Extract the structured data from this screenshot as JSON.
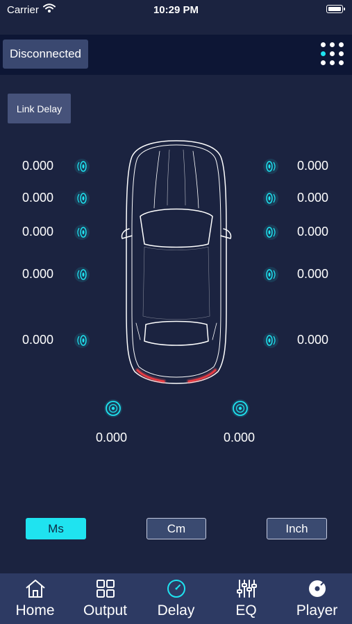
{
  "status_bar": {
    "carrier": "Carrier",
    "time": "10:29 PM"
  },
  "header": {
    "connection_status": "Disconnected",
    "menu_icon": "grid-dots-icon"
  },
  "link_delay_label": "Link Delay",
  "delays": {
    "left": [
      "0.000",
      "0.000",
      "0.000",
      "0.000",
      "0.000"
    ],
    "right": [
      "0.000",
      "0.000",
      "0.000",
      "0.000",
      "0.000"
    ],
    "sub_left": "0.000",
    "sub_right": "0.000"
  },
  "units": {
    "ms": "Ms",
    "cm": "Cm",
    "inch": "Inch",
    "selected": "Ms"
  },
  "tabs": [
    {
      "label": "Home",
      "icon": "home-icon"
    },
    {
      "label": "Output",
      "icon": "output-grid-icon"
    },
    {
      "label": "Delay",
      "icon": "delay-gauge-icon"
    },
    {
      "label": "EQ",
      "icon": "eq-sliders-icon"
    },
    {
      "label": "Player",
      "icon": "player-disc-icon"
    }
  ],
  "active_tab": "Delay",
  "colors": {
    "accent": "#1fe3f0",
    "background": "#1b2340",
    "header": "#0d1635",
    "tabbar": "#2d3a63",
    "tail_light": "#e0303a"
  }
}
